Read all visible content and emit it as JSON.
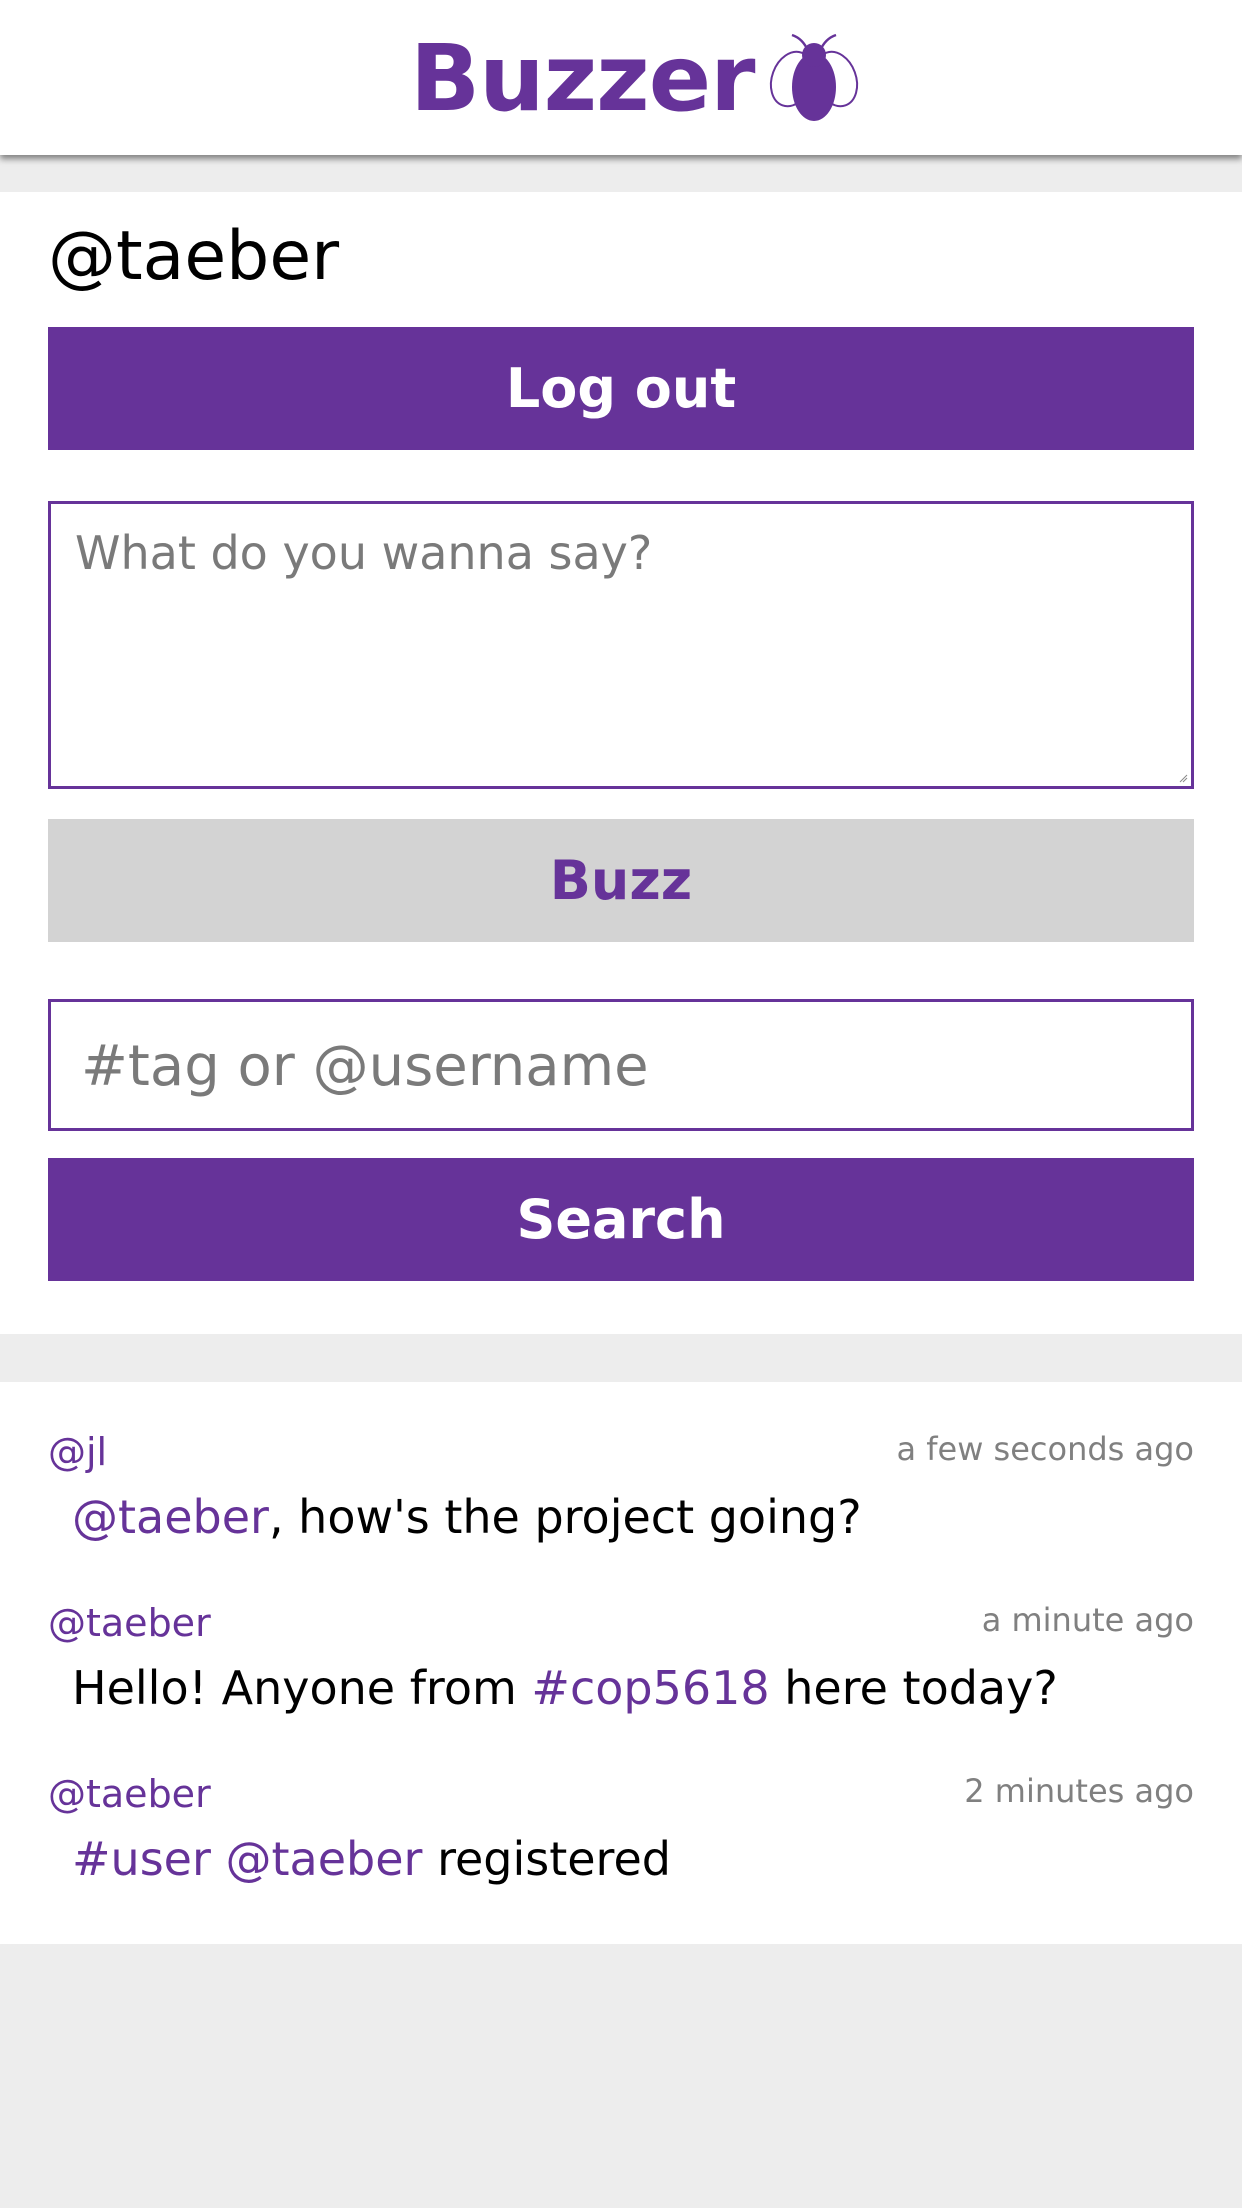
{
  "app": {
    "name": "Buzzer",
    "brand_color": "#663399",
    "logo_icon": "bee-icon"
  },
  "user": {
    "handle": "@taeber"
  },
  "actions": {
    "logout_label": "Log out",
    "compose_placeholder": "What do you wanna say?",
    "buzz_label": "Buzz",
    "search_placeholder": "#tag or @username",
    "search_label": "Search"
  },
  "feed": {
    "posts": [
      {
        "author": "@jl",
        "time": "a few seconds ago",
        "segments": [
          {
            "text": "@taeber",
            "kind": "mention"
          },
          {
            "text": ", how's the project going?",
            "kind": "text"
          }
        ]
      },
      {
        "author": "@taeber",
        "time": "a minute ago",
        "segments": [
          {
            "text": "Hello! Anyone from ",
            "kind": "text"
          },
          {
            "text": "#cop5618",
            "kind": "tag"
          },
          {
            "text": " here today?",
            "kind": "text"
          }
        ]
      },
      {
        "author": "@taeber",
        "time": "2 minutes ago",
        "segments": [
          {
            "text": "#user",
            "kind": "tag"
          },
          {
            "text": " ",
            "kind": "text"
          },
          {
            "text": "@taeber",
            "kind": "mention"
          },
          {
            "text": " registered",
            "kind": "text"
          }
        ]
      }
    ]
  }
}
